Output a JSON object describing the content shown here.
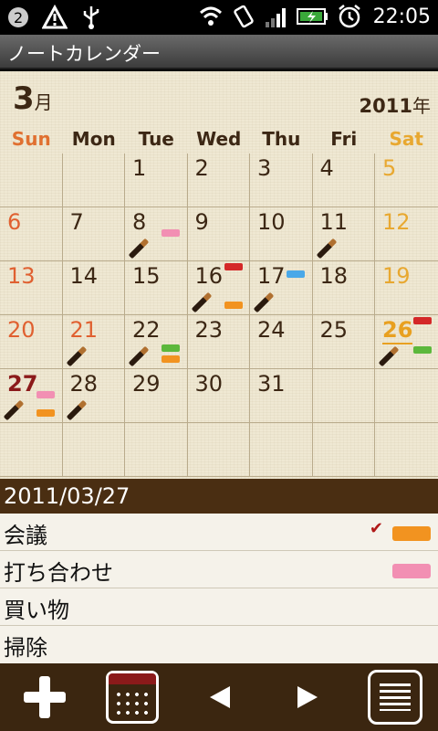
{
  "status_bar": {
    "time": "22:05"
  },
  "app": {
    "title": "ノートカレンダー"
  },
  "calendar": {
    "month": "3",
    "month_suffix": "月",
    "year": "2011",
    "year_suffix": "年",
    "weekdays": [
      "Sun",
      "Mon",
      "Tue",
      "Wed",
      "Thu",
      "Fri",
      "Sat"
    ],
    "days": [
      "",
      "",
      "1",
      "2",
      "3",
      "4",
      "5",
      "6",
      "7",
      "8",
      "9",
      "10",
      "11",
      "12",
      "13",
      "14",
      "15",
      "16",
      "17",
      "18",
      "19",
      "20",
      "21",
      "22",
      "23",
      "24",
      "25",
      "26",
      "27",
      "28",
      "29",
      "30",
      "31",
      "",
      "",
      "",
      "",
      "",
      "",
      "",
      "",
      ""
    ],
    "colors": {
      "sunday": "#e06030",
      "saturday": "#e8a830",
      "pink": "#f28fb3",
      "red": "#d42828",
      "blue": "#4aa8e8",
      "green": "#5cb83c",
      "orange": "#f29320"
    }
  },
  "selected": {
    "date": "2011/03/27",
    "events": [
      {
        "label": "会議",
        "checked": true,
        "tag_color": "#f29320"
      },
      {
        "label": "打ち合わせ",
        "checked": false,
        "tag_color": "#f28fb3"
      },
      {
        "label": "買い物",
        "checked": false,
        "tag_color": ""
      },
      {
        "label": "掃除",
        "checked": false,
        "tag_color": ""
      }
    ]
  },
  "toolbar": {
    "icons": [
      "add-icon",
      "calendar-icon",
      "previous-arrow-icon",
      "next-arrow-icon",
      "list-icon"
    ]
  }
}
